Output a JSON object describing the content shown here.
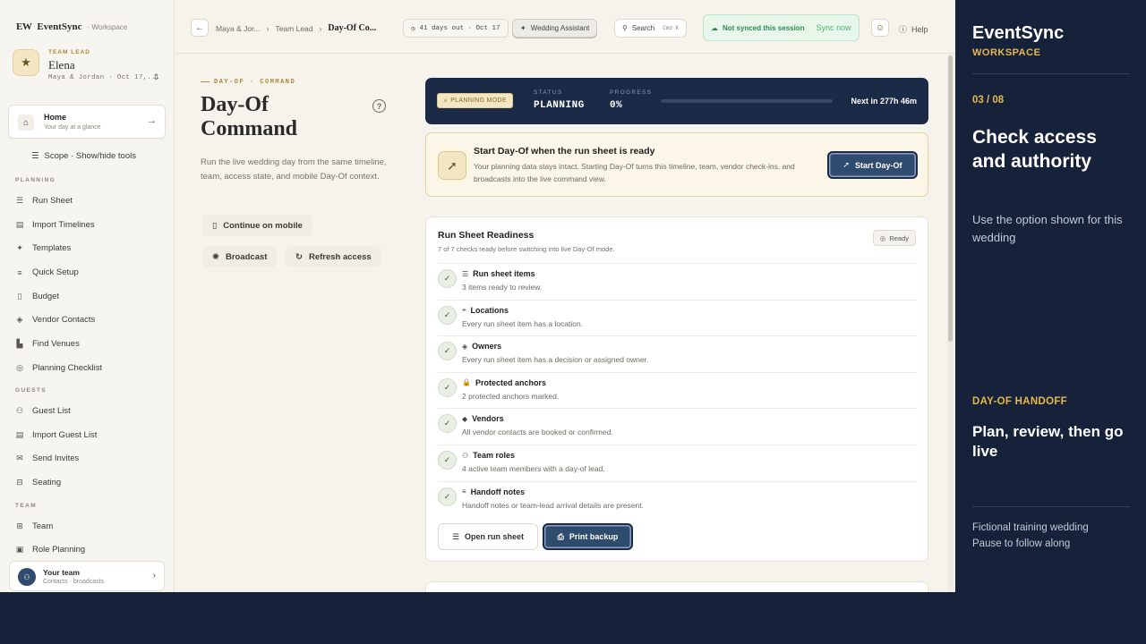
{
  "brand": {
    "logo": "EW",
    "name": "EventSync",
    "workspace": "· Workspace"
  },
  "user": {
    "role": "TEAM LEAD",
    "name": "Elena",
    "wedding": "Maya & Jordan · Oct 17,...",
    "swap": "⇕"
  },
  "home": {
    "title": "Home",
    "subtitle": "Your day at a glance"
  },
  "scope": {
    "label": "Scope · Show/hide tools"
  },
  "sidebar": {
    "planning_label": "PLANNING",
    "planning": [
      "Run Sheet",
      "Import Timelines",
      "Templates",
      "Quick Setup",
      "Budget",
      "Vendor Contacts",
      "Find Venues",
      "Planning Checklist"
    ],
    "guests_label": "GUESTS",
    "guests": [
      "Guest List",
      "Import Guest List",
      "Send Invites",
      "Seating"
    ],
    "team_label": "TEAM",
    "team": [
      "Team",
      "Role Planning"
    ]
  },
  "team_card": {
    "title": "Your team",
    "subtitle": "Contacts · broadcasts"
  },
  "topbar": {
    "crumbs": [
      "Maya & Jor...",
      "Team Lead",
      "Day-Of Co..."
    ],
    "days": "41 days out · Oct 17",
    "assistant": "Wedding Assistant",
    "search": "Search",
    "search_kbd": "Cmd K",
    "sync_status": "Not synced this session",
    "sync_now": "Sync now",
    "help": "Help"
  },
  "page": {
    "eyebrow": "DAY-OF · COMMAND",
    "title": "Day-Of Command",
    "description": "Run the live wedding day from the same timeline, team, access state, and mobile Day-Of context.",
    "continue_mobile": "Continue on mobile",
    "broadcast": "Broadcast",
    "refresh": "Refresh access"
  },
  "mode": {
    "badge": "PLANNING MODE",
    "status_label": "STATUS",
    "status_value": "PLANNING",
    "progress_label": "PROGRESS",
    "progress_value": "0%",
    "progress_fraction": 0,
    "next": "Next in 277h 46m"
  },
  "start": {
    "title": "Start Day-Of when the run sheet is ready",
    "description": "Your planning data stays intact. Starting Day-Of turns this timeline, team, vendor check-ins, and broadcasts into the live command view.",
    "button": "Start Day-Of"
  },
  "readiness": {
    "title": "Run Sheet Readiness",
    "subtitle": "7 of 7 checks ready before switching into live Day-Of mode.",
    "badge": "Ready",
    "checks": [
      {
        "title": "Run sheet items",
        "desc": "3 items ready to review.",
        "icon": "list-icon"
      },
      {
        "title": "Locations",
        "desc": "Every run sheet item has a location.",
        "icon": "pin-icon"
      },
      {
        "title": "Owners",
        "desc": "Every run sheet item has a decision or assigned owner.",
        "icon": "badge-check-icon"
      },
      {
        "title": "Protected anchors",
        "desc": "2 protected anchors marked.",
        "icon": "lock-icon"
      },
      {
        "title": "Vendors",
        "desc": "All vendor contacts are booked or confirmed.",
        "icon": "shield-icon"
      },
      {
        "title": "Team roles",
        "desc": "4 active team members with a day-of lead.",
        "icon": "users-icon"
      },
      {
        "title": "Handoff notes",
        "desc": "Handoff notes or team-lead arrival details are present.",
        "icon": "notes-icon"
      }
    ],
    "open_button": "Open run sheet",
    "print_button": "Print backup"
  },
  "panel": {
    "title": "EventSync",
    "subtitle": "WORKSPACE",
    "step": "03 / 08",
    "heading": "Check access and authority",
    "text": "Use the option shown for this wedding",
    "kicker": "DAY-OF HANDOFF",
    "heading2": "Plan, review, then go live",
    "foot1": "Fictional training wedding",
    "foot2": "Pause to follow along"
  },
  "colors": {
    "navy": "#1b2a46",
    "gold": "#e6b84e",
    "button": "#2f4b6e",
    "sync_green": "#2f8a4c"
  }
}
